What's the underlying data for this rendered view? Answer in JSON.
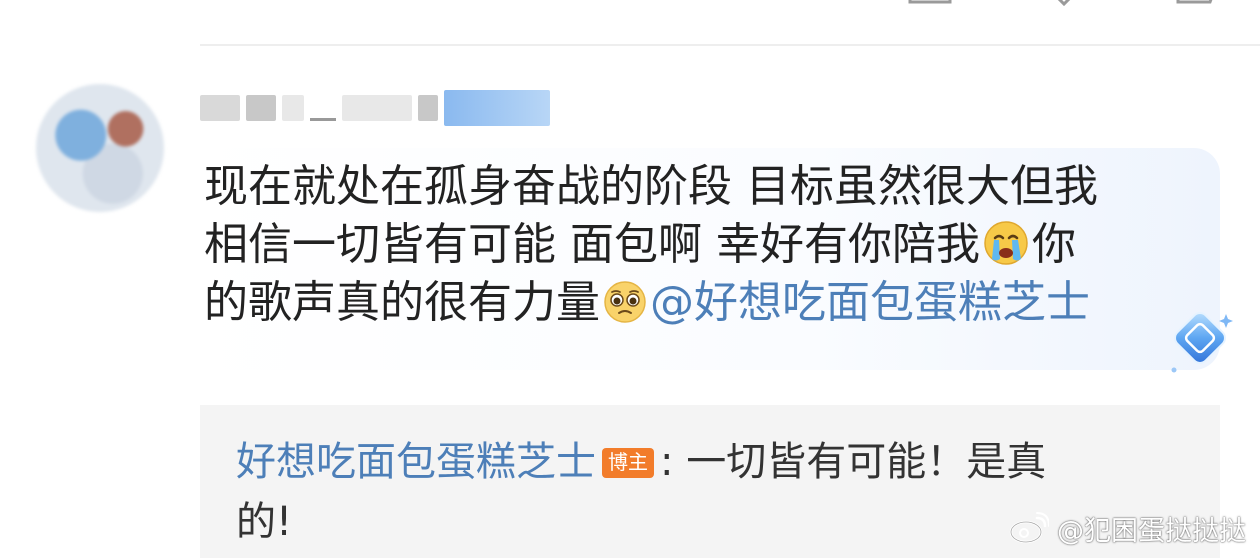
{
  "comment": {
    "lines": [
      "现在就处在孤身奋战的阶段 目标虽然很大但我",
      "相信一切皆有可能 面包啊 幸好有你陪我",
      "你",
      "的歌声真的很有力量",
      "@好想吃面包蛋糕芝士"
    ]
  },
  "reply": {
    "author": "好想吃面包蛋糕芝士",
    "badge": "博主",
    "separator": ":",
    "text_line1": "一切皆有可能！是真",
    "text_line2": "的!"
  },
  "watermark": {
    "text": "@犯困蛋挞挞挞"
  },
  "icons": {
    "emoji_crying": "crying-emoji-icon",
    "emoji_pleading": "pleading-emoji-icon",
    "badge_diamond": "diamond-badge-icon",
    "weibo_logo": "weibo-logo-icon"
  },
  "colors": {
    "mention": "#4d7fb8",
    "host_badge": "#f27c2a",
    "reply_background": "#f4f4f4"
  }
}
